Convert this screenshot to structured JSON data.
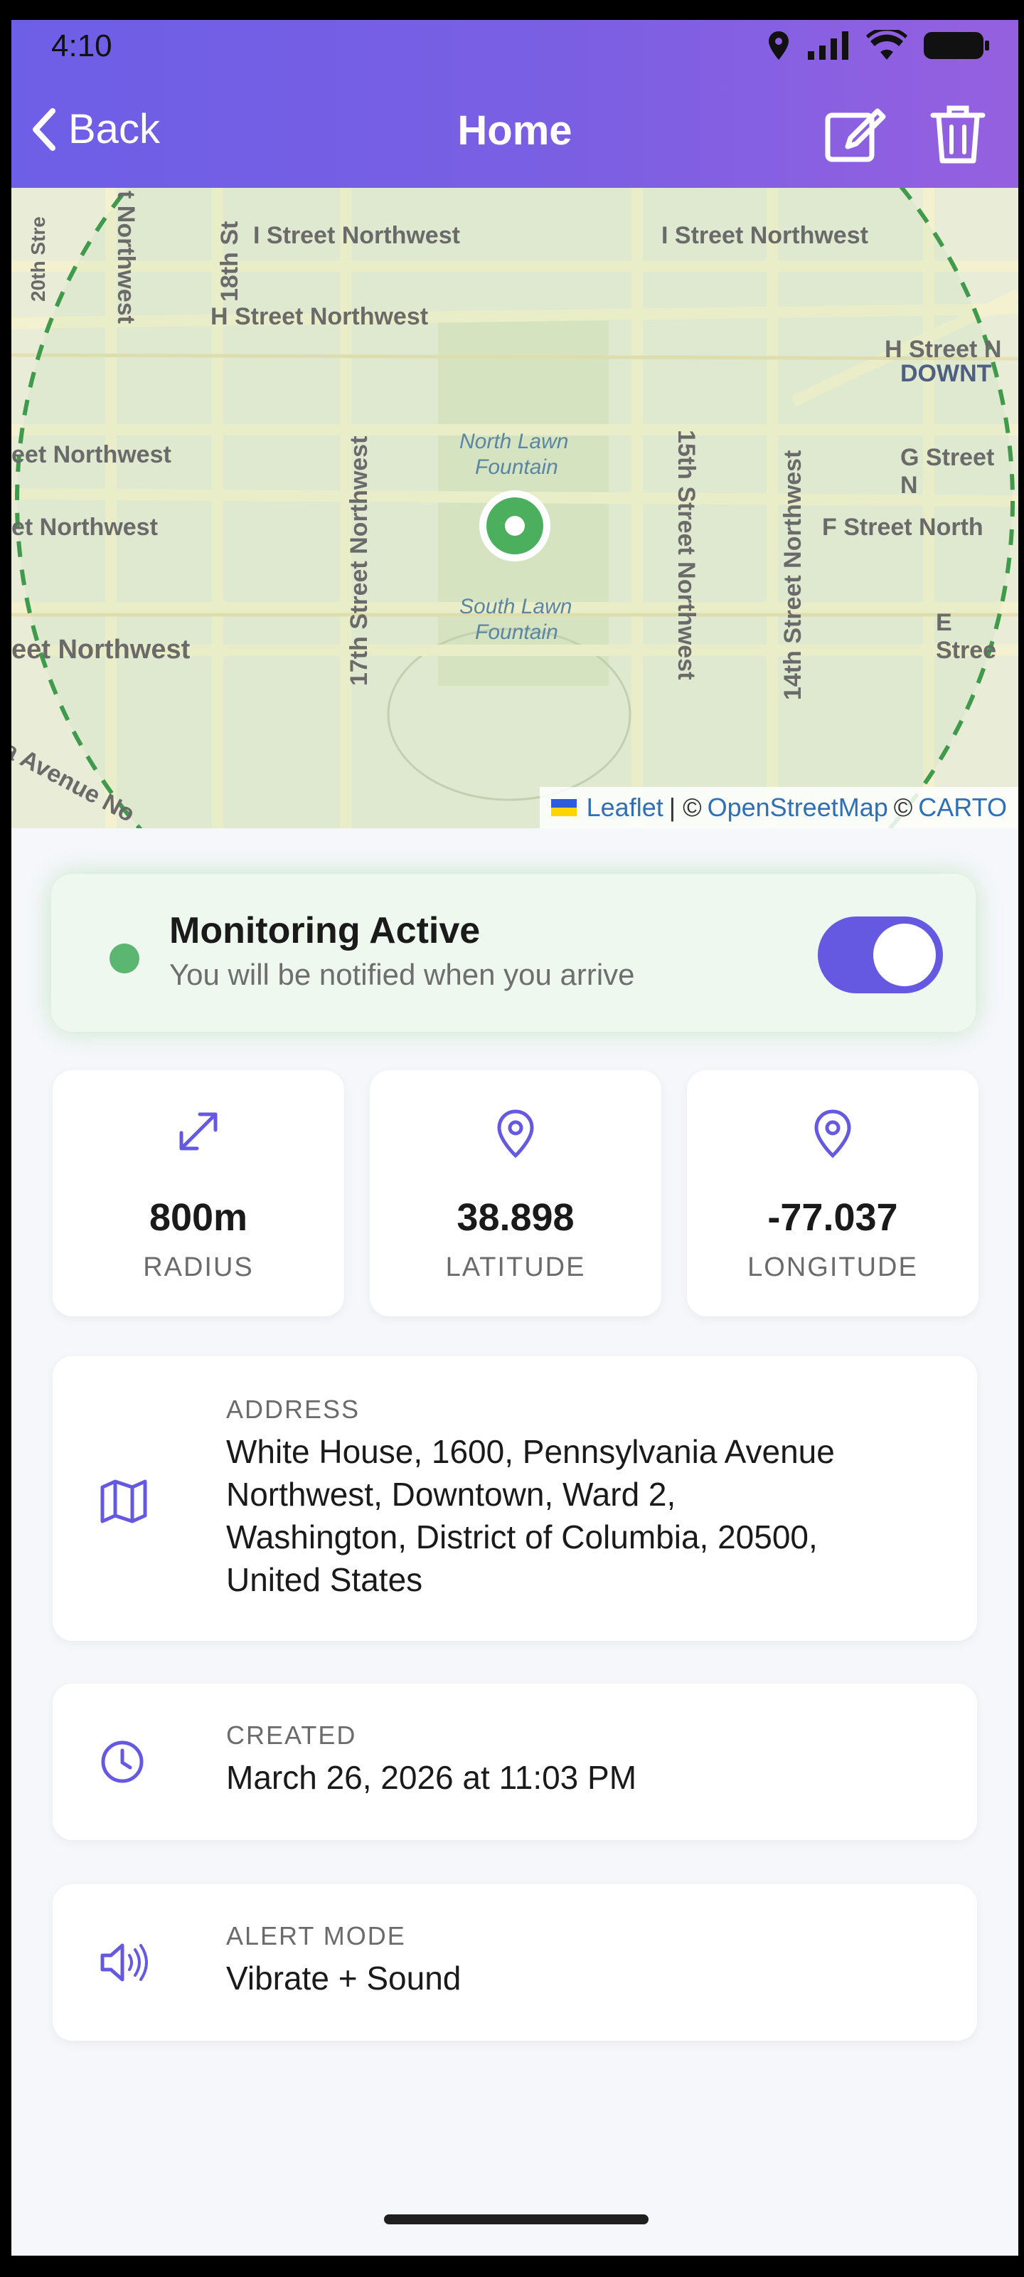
{
  "status_bar": {
    "time": "4:10"
  },
  "header": {
    "back_label": "Back",
    "title": "Home"
  },
  "map": {
    "streets": [
      "I Street Northwest",
      "I Street Northwest",
      "H Street Northwest",
      "H Street N",
      "DOWNT",
      "17th Street Northwest",
      "15th Street Northwest",
      "14th Street Northwest",
      "18th St",
      "eet Northwest",
      "et Northwest",
      "eet Northwest",
      "G Street N",
      "F Street North",
      "E Stree",
      "20th Stre",
      "t Northwest",
      "a Avenue No"
    ],
    "landmarks": [
      "North Lawn",
      "Fountain",
      "South Lawn",
      "Fountain"
    ],
    "attribution": {
      "leaflet": "Leaflet",
      "sep": "| ©",
      "osm": "OpenStreetMap",
      "carto_prefix": "©",
      "carto": "CARTO"
    }
  },
  "monitoring": {
    "title": "Monitoring Active",
    "subtitle": "You will be notified when you arrive",
    "enabled": true
  },
  "stats": [
    {
      "icon": "expand-arrows-icon",
      "value": "800m",
      "label": "RADIUS"
    },
    {
      "icon": "map-pin-icon",
      "value": "38.898",
      "label": "LATITUDE"
    },
    {
      "icon": "map-pin-icon",
      "value": "-77.037",
      "label": "LONGITUDE"
    }
  ],
  "address": {
    "caption": "ADDRESS",
    "lines": [
      "White House, 1600, Pennsylvania Avenue",
      "Northwest, Downtown, Ward 2,",
      "Washington, District of Columbia, 20500,",
      "United States"
    ]
  },
  "created": {
    "caption": "CREATED",
    "value": "March 26, 2026 at 11:03 PM"
  },
  "alert_mode": {
    "caption": "ALERT MODE",
    "value": "Vibrate + Sound"
  },
  "colors": {
    "accent": "#6459e0",
    "active_green": "#5bb672",
    "header_start": "#6d5fe6",
    "header_end": "#9560e0"
  }
}
